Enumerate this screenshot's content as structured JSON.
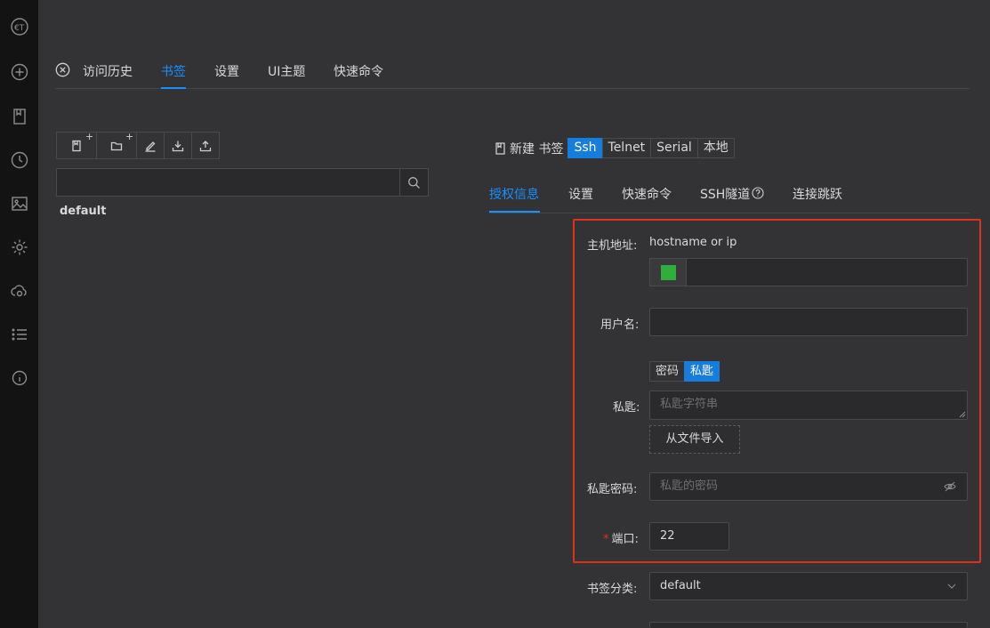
{
  "sidebar": {
    "icons": [
      "logo-icon",
      "add-icon",
      "bookmark-icon",
      "history-icon",
      "image-icon",
      "settings-icon",
      "cloud-sync-icon",
      "list-icon",
      "info-icon"
    ]
  },
  "tabs": {
    "items": [
      {
        "label": "访问历史"
      },
      {
        "label": "书签",
        "active": true
      },
      {
        "label": "设置"
      },
      {
        "label": "UI主题"
      },
      {
        "label": "快速命令"
      }
    ]
  },
  "tree": {
    "default_item": "default"
  },
  "form_header": {
    "new_label": "新建 书签",
    "protocols": [
      {
        "label": "Ssh",
        "active": true
      },
      {
        "label": "Telnet"
      },
      {
        "label": "Serial"
      },
      {
        "label": "本地"
      }
    ]
  },
  "subtabs": {
    "items": [
      {
        "label": "授权信息",
        "active": true
      },
      {
        "label": "设置"
      },
      {
        "label": "快速命令"
      },
      {
        "label": "SSH隧道"
      },
      {
        "label": "连接跳跃"
      }
    ]
  },
  "form": {
    "host_label": "主机地址:",
    "host_hint": "hostname or ip",
    "username_label": "用户名:",
    "auth_options": [
      {
        "label": "密码"
      },
      {
        "label": "私匙",
        "active": true
      }
    ],
    "private_key_label": "私匙:",
    "private_key_placeholder": "私匙字符串",
    "import_button": "从文件导入",
    "passphrase_label": "私匙密码:",
    "passphrase_placeholder": "私匙的密码",
    "port_required": "*",
    "port_label": "端口:",
    "port_value": "22",
    "category_label": "书签分类:",
    "category_value": "default"
  },
  "colors": {
    "accent": "#1890ff",
    "highlight_box": "#e0301e",
    "color_tag": "#2fae3e"
  }
}
